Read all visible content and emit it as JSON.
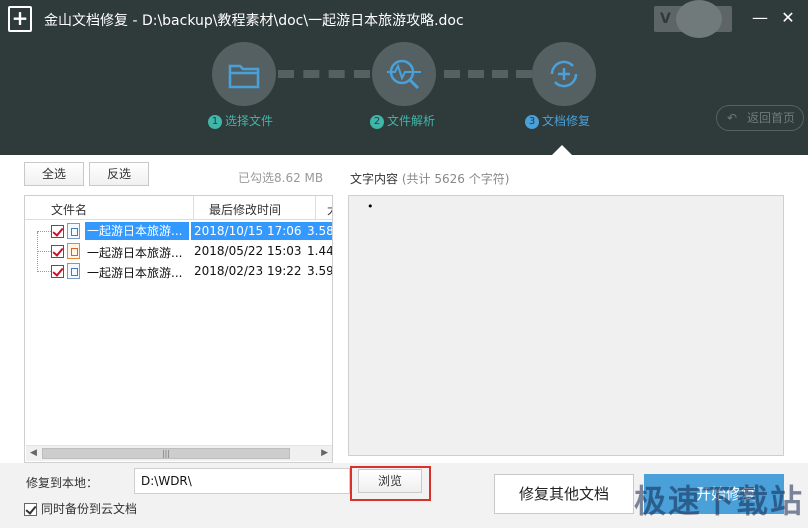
{
  "window": {
    "title": "金山文档修复 - D:\\backup\\教程素材\\doc\\一起游日本旅游攻略.doc",
    "vip_label": "V",
    "minimize_icon": "minimize-icon",
    "close_icon": "close-icon"
  },
  "steps": [
    {
      "num": "1",
      "label": "选择文件",
      "icon": "folder-icon",
      "active": false
    },
    {
      "num": "2",
      "label": "文件解析",
      "icon": "scan-icon",
      "active": false
    },
    {
      "num": "3",
      "label": "文档修复",
      "icon": "repair-icon",
      "active": true
    }
  ],
  "colors": {
    "header_bg": "#2f3a3b",
    "step_inactive_text": "#3fb6a8",
    "step_active_text": "#4aa0d8",
    "highlight": "#d9322b",
    "primary_button": "#4aa0d8"
  },
  "back_button": {
    "label": "返回首页"
  },
  "toolbar": {
    "select_all": "全选",
    "invert": "反选",
    "selected_info": "已勾选8.62 MB"
  },
  "file_list": {
    "columns": [
      "文件名",
      "最后修改时间",
      "大"
    ],
    "rows": [
      {
        "name": "一起游日本旅游...",
        "modified": "2018/10/15 17:06",
        "size": "3.58",
        "checked": true,
        "selected": true,
        "icon": "doc-file-icon"
      },
      {
        "name": "一起游日本旅游...",
        "modified": "2018/05/22 15:03",
        "size": "1.44",
        "checked": true,
        "selected": false,
        "icon": "ppt-file-icon"
      },
      {
        "name": "一起游日本旅游...",
        "modified": "2018/02/23 19:22",
        "size": "3.59",
        "checked": true,
        "selected": false,
        "icon": "doc-file-icon"
      }
    ]
  },
  "content": {
    "label": "文字内容",
    "count": "(共计 5626 个字符)",
    "text": "•"
  },
  "bottom": {
    "restore_label": "修复到本地：",
    "path_value": "D:\\WDR\\",
    "browse": "浏览",
    "backup_label": "同时备份到云文档",
    "backup_checked": true,
    "repair_other": "修复其他文档",
    "start_repair": "开始修复",
    "watermark": "极速下载站"
  }
}
